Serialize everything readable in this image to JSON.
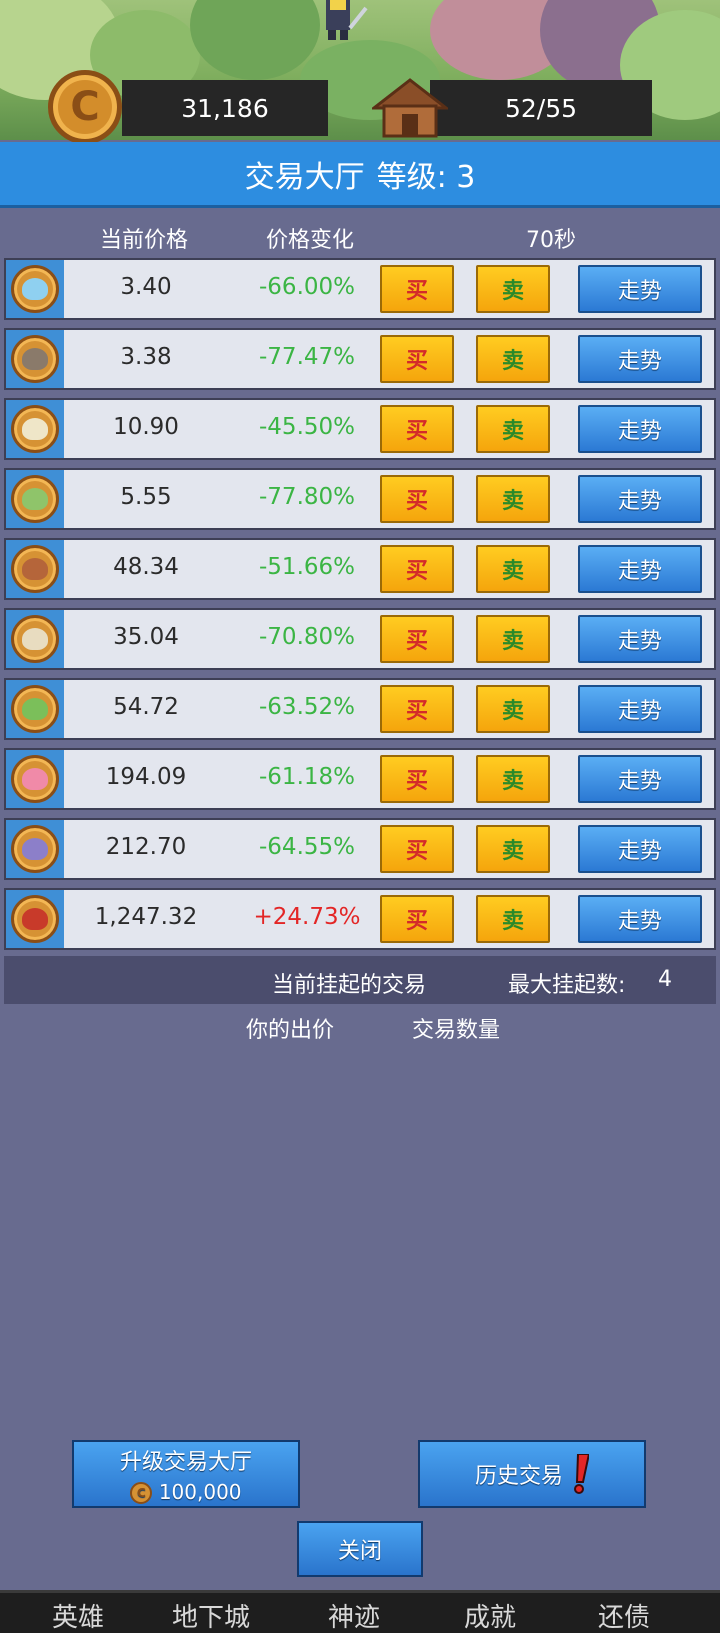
{
  "header": {
    "coins": "31,186",
    "capacity": "52/55"
  },
  "title": {
    "name": "交易大厅",
    "level": "等级: 3"
  },
  "columns": {
    "price": "当前价格",
    "change": "价格变化",
    "timer": "70秒"
  },
  "buttons": {
    "buy": "买",
    "sell": "卖",
    "trend": "走势"
  },
  "rows": [
    {
      "icon": "slime-icon",
      "price": "3.40",
      "change": "-66.00%",
      "color": "#3bb544"
    },
    {
      "icon": "zombie-icon",
      "price": "3.38",
      "change": "-77.47%",
      "color": "#3bb544"
    },
    {
      "icon": "skull-icon",
      "price": "10.90",
      "change": "-45.50%",
      "color": "#3bb544"
    },
    {
      "icon": "goblin-icon",
      "price": "5.55",
      "change": "-77.80%",
      "color": "#3bb544"
    },
    {
      "icon": "treant-icon",
      "price": "48.34",
      "change": "-51.66%",
      "color": "#3bb544"
    },
    {
      "icon": "wolf-icon",
      "price": "35.04",
      "change": "-70.80%",
      "color": "#3bb544"
    },
    {
      "icon": "orc-icon",
      "price": "54.72",
      "change": "-63.52%",
      "color": "#3bb544"
    },
    {
      "icon": "mushroom-icon",
      "price": "194.09",
      "change": "-61.18%",
      "color": "#3bb544"
    },
    {
      "icon": "bat-icon",
      "price": "212.70",
      "change": "-64.55%",
      "color": "#3bb544"
    },
    {
      "icon": "dragon-icon",
      "price": "1,247.32",
      "change": "+24.73%",
      "color": "#e32626"
    }
  ],
  "pending": {
    "label": "当前挂起的交易",
    "max_label": "最大挂起数:",
    "max_value": "4",
    "bid_header": "你的出价",
    "qty_header": "交易数量"
  },
  "actions": {
    "upgrade_label": "升级交易大厅",
    "upgrade_cost": "100,000",
    "history_label": "历史交易",
    "close_label": "关闭"
  },
  "nav": [
    "英雄",
    "地下城",
    "神迹",
    "成就",
    "还债"
  ]
}
